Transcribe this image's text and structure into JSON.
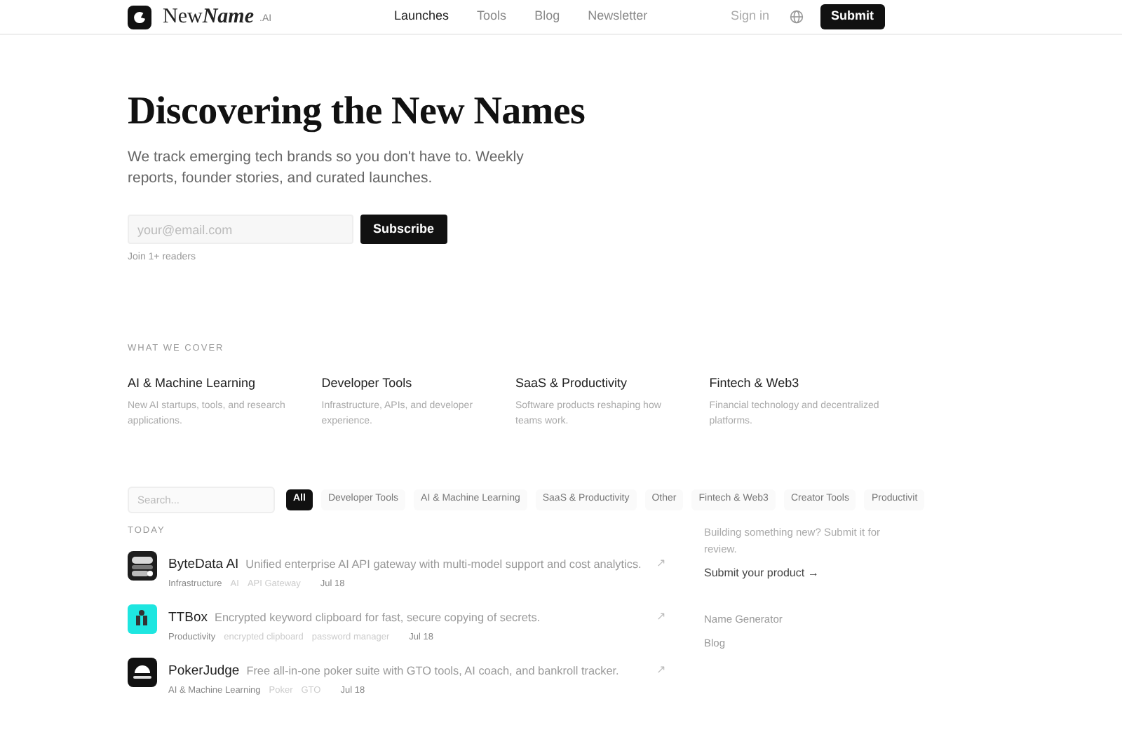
{
  "nav": {
    "brand": "New",
    "brand_italic": "Name",
    "brand_suffix": ".AI",
    "links": [
      {
        "label": "Launches",
        "selected": true
      },
      {
        "label": "Tools",
        "selected": false
      },
      {
        "label": "Blog",
        "selected": false
      },
      {
        "label": "Newsletter",
        "selected": false
      }
    ],
    "sign_in": "Sign in",
    "submit": "Submit"
  },
  "hero": {
    "title": "Discovering the New Names",
    "subtitle": "We track emerging tech brands so you don't have to. Weekly reports, founder stories, and curated launches.",
    "email_placeholder": "your@email.com",
    "subscribe": "Subscribe",
    "note": "Join 1+ readers"
  },
  "coverage": {
    "heading": "WHAT WE COVER",
    "items": [
      {
        "title": "AI & Machine Learning",
        "text": "New AI startups, tools, and research applications."
      },
      {
        "title": "Developer Tools",
        "text": "Infrastructure, APIs, and developer experience."
      },
      {
        "title": "SaaS & Productivity",
        "text": "Software products reshaping how teams work."
      },
      {
        "title": "Fintech & Web3",
        "text": "Financial technology and decentralized platforms."
      }
    ]
  },
  "filters": {
    "search_placeholder": "Search...",
    "chips": [
      {
        "label": "All",
        "selected": true
      },
      {
        "label": "Developer Tools",
        "selected": false
      },
      {
        "label": "AI & Machine Learning",
        "selected": false
      },
      {
        "label": "SaaS & Productivity",
        "selected": false
      },
      {
        "label": "Other",
        "selected": false
      },
      {
        "label": "Fintech & Web3",
        "selected": false
      },
      {
        "label": "Creator Tools",
        "selected": false
      },
      {
        "label": "Productivit",
        "selected": false
      }
    ]
  },
  "launches": {
    "heading": "TODAY",
    "items": [
      {
        "name": "ByteData AI",
        "kind": "stack",
        "description": "Unified enterprise AI API gateway with multi-model support and cost analytics.",
        "category": "Infrastructure",
        "tags": [
          "AI",
          "API Gateway"
        ],
        "date": "Jul 18",
        "arrow": "↗"
      },
      {
        "name": "TTBox",
        "kind": "figure",
        "description": "Encrypted keyword clipboard for fast, secure copying of secrets.",
        "category": "Productivity",
        "tags": [
          "encrypted clipboard",
          "password manager"
        ],
        "date": "Jul 18",
        "arrow": "↗"
      },
      {
        "name": "PokerJudge",
        "kind": "chips",
        "description": "Free all-in-one poker suite with GTO tools, AI coach, and bankroll tracker.",
        "category": "AI & Machine Learning",
        "tags": [
          "Poker",
          "GTO"
        ],
        "date": "Jul 18",
        "arrow": "↗"
      }
    ]
  },
  "sidebar": {
    "text": "Building something new? Submit it for review.",
    "link": "Submit your product →",
    "links": [
      "Name Generator",
      "Blog"
    ]
  }
}
